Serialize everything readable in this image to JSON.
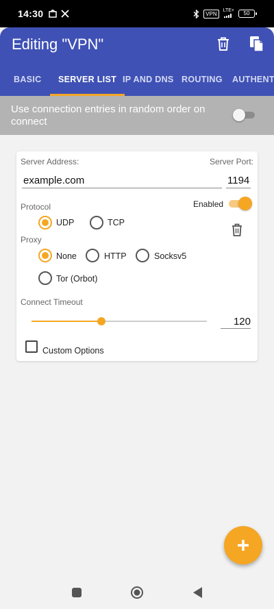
{
  "status_bar": {
    "time": "14:30",
    "vpn_badge": "VPN",
    "network": "LTE+",
    "battery": "50"
  },
  "app_bar": {
    "title": "Editing \"VPN\"",
    "tabs": [
      {
        "label": "BASIC",
        "active": false
      },
      {
        "label": "SERVER LIST",
        "active": true
      },
      {
        "label": "IP AND DNS",
        "active": false
      },
      {
        "label": "ROUTING",
        "active": false
      },
      {
        "label": "AUTHENTICATION",
        "active": false
      }
    ]
  },
  "random_order": {
    "text": "Use connection entries in random order on connect",
    "enabled": false
  },
  "server": {
    "address_label": "Server Address:",
    "address_value": "example.com",
    "port_label": "Server Port:",
    "port_value": "1194",
    "enabled_label": "Enabled",
    "enabled": true,
    "protocol_label": "Protocol",
    "protocol_options": [
      "UDP",
      "TCP"
    ],
    "protocol_selected": "UDP",
    "proxy_label": "Proxy",
    "proxy_options": [
      "None",
      "HTTP",
      "Socksv5",
      "Tor (Orbot)"
    ],
    "proxy_selected": "None",
    "timeout_label": "Connect Timeout",
    "timeout_value": "120",
    "timeout_fraction": 0.4,
    "custom_options_label": "Custom Options",
    "custom_options_checked": false
  },
  "colors": {
    "primary": "#3f51b5",
    "accent": "#f5a623"
  },
  "icons": [
    "delete-icon",
    "copy-icon",
    "add-icon",
    "recents-icon",
    "home-icon",
    "back-icon",
    "bluetooth-icon",
    "x-icon"
  ]
}
